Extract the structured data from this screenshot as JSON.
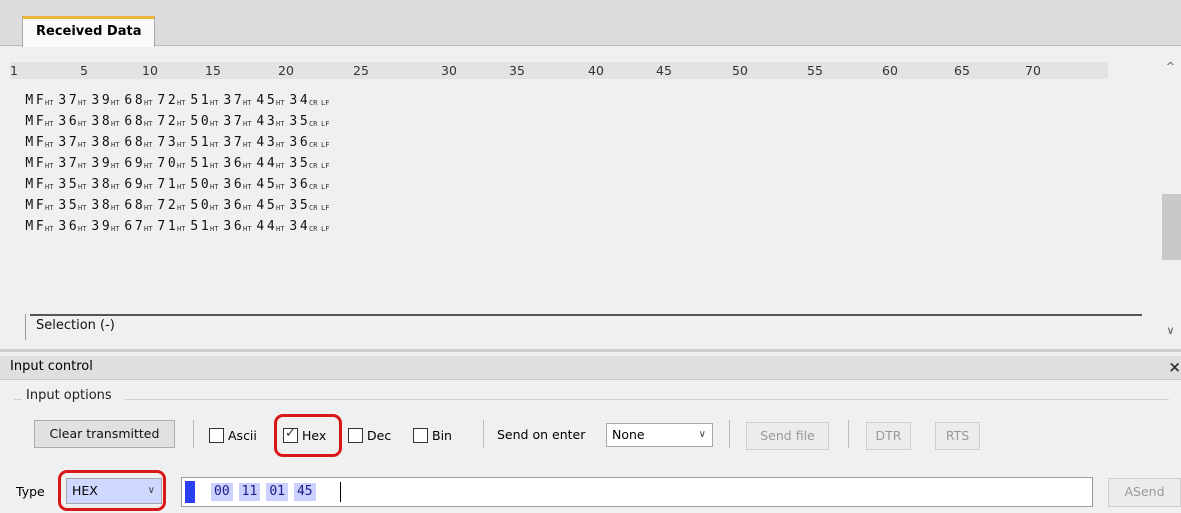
{
  "received": {
    "tab_label": "Received Data",
    "ruler": [
      "1",
      "5",
      "10",
      "15",
      "20",
      "25",
      "30",
      "35",
      "40",
      "45",
      "50",
      "55",
      "60",
      "65",
      "70"
    ],
    "lines": [
      [
        "M",
        "F",
        "HT",
        "3",
        "7",
        "HT",
        "3",
        "9",
        "HT",
        "6",
        "8",
        "HT",
        "7",
        "2",
        "HT",
        "5",
        "1",
        "HT",
        "3",
        "7",
        "HT",
        "4",
        "5",
        "HT",
        "3",
        "4",
        "CR",
        "LF"
      ],
      [
        "M",
        "F",
        "HT",
        "3",
        "6",
        "HT",
        "3",
        "8",
        "HT",
        "6",
        "8",
        "HT",
        "7",
        "2",
        "HT",
        "5",
        "0",
        "HT",
        "3",
        "7",
        "HT",
        "4",
        "3",
        "HT",
        "3",
        "5",
        "CR",
        "LF"
      ],
      [
        "M",
        "F",
        "HT",
        "3",
        "7",
        "HT",
        "3",
        "8",
        "HT",
        "6",
        "8",
        "HT",
        "7",
        "3",
        "HT",
        "5",
        "1",
        "HT",
        "3",
        "7",
        "HT",
        "4",
        "3",
        "HT",
        "3",
        "6",
        "CR",
        "LF"
      ],
      [
        "M",
        "F",
        "HT",
        "3",
        "7",
        "HT",
        "3",
        "9",
        "HT",
        "6",
        "9",
        "HT",
        "7",
        "0",
        "HT",
        "5",
        "1",
        "HT",
        "3",
        "6",
        "HT",
        "4",
        "4",
        "HT",
        "3",
        "5",
        "CR",
        "LF"
      ],
      [
        "M",
        "F",
        "HT",
        "3",
        "5",
        "HT",
        "3",
        "8",
        "HT",
        "6",
        "9",
        "HT",
        "7",
        "1",
        "HT",
        "5",
        "0",
        "HT",
        "3",
        "6",
        "HT",
        "4",
        "5",
        "HT",
        "3",
        "6",
        "CR",
        "LF"
      ],
      [
        "M",
        "F",
        "HT",
        "3",
        "5",
        "HT",
        "3",
        "8",
        "HT",
        "6",
        "8",
        "HT",
        "7",
        "2",
        "HT",
        "5",
        "0",
        "HT",
        "3",
        "6",
        "HT",
        "4",
        "5",
        "HT",
        "3",
        "5",
        "CR",
        "LF"
      ],
      [
        "M",
        "F",
        "HT",
        "3",
        "6",
        "HT",
        "3",
        "9",
        "HT",
        "6",
        "7",
        "HT",
        "7",
        "1",
        "HT",
        "5",
        "1",
        "HT",
        "3",
        "6",
        "HT",
        "4",
        "4",
        "HT",
        "3",
        "4",
        "CR",
        "LF"
      ]
    ],
    "selection_label": "Selection (-)",
    "scroll_up_icon": "chevron-up-icon",
    "scroll_down_icon": "chevron-down-icon"
  },
  "input_control": {
    "title": "Input control",
    "close_glyph": "×",
    "group_label": "Input options",
    "clear_button": "Clear transmitted",
    "checkboxes": [
      {
        "label": "Ascii",
        "checked": false
      },
      {
        "label": "Hex",
        "checked": true
      },
      {
        "label": "Dec",
        "checked": false
      },
      {
        "label": "Bin",
        "checked": false
      }
    ],
    "send_on_enter_label": "Send on enter",
    "send_on_enter_value": "None",
    "send_file_button": "Send file",
    "dtr_button": "DTR",
    "rts_button": "RTS",
    "type_label": "Type",
    "type_value": "HEX",
    "hex_bytes": [
      "00",
      "11",
      "01",
      "45"
    ],
    "asend_button": "ASend"
  },
  "colors": {
    "highlight": "#d81818",
    "tab_accent": "#e9b53d",
    "hex_byte_bg": "#cbd0ff",
    "caret": "#2a3ff0"
  }
}
